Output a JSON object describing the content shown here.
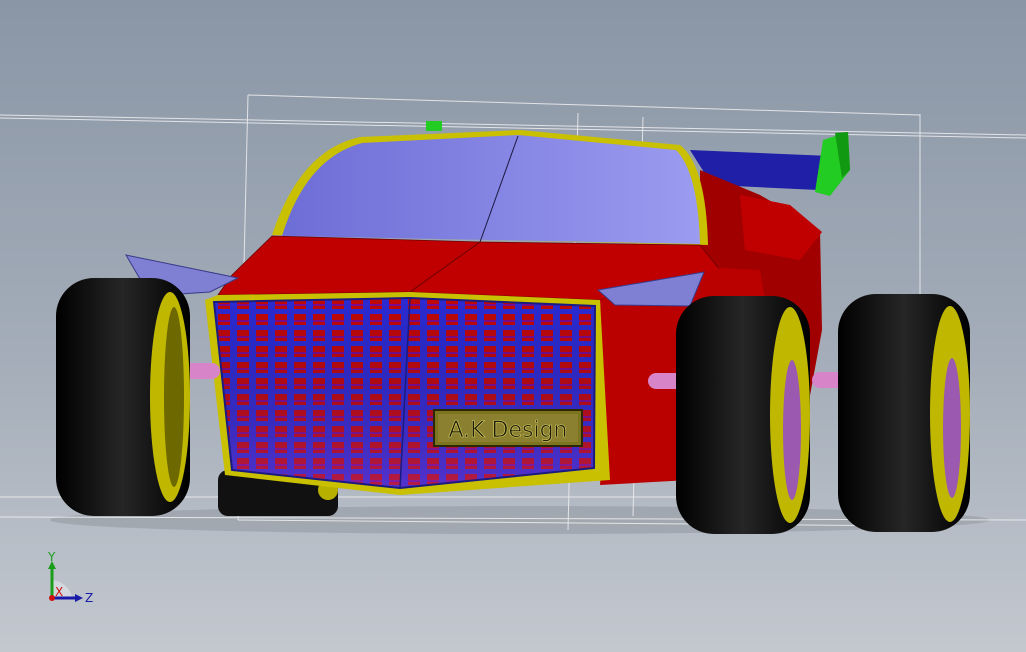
{
  "badge": {
    "text": "A.K Design"
  },
  "triad": {
    "y_label": "Y",
    "z_label": "Z",
    "x_label": "X"
  },
  "colors": {
    "background_top": "#8a96a6",
    "background_bottom": "#c3c8cf",
    "body": "#c00000",
    "body_shadow": "#990000",
    "trim": "#c8c000",
    "windshield": "#8585e0",
    "grille": "#2a2ad0",
    "tire": "#0a0a0a",
    "rim": "#b8b000",
    "axle": "#d884c8",
    "spoiler_wing": "#1e1ea8",
    "spoiler_endplate": "#22cc22",
    "mirror": "#7f7fd4"
  },
  "icons": {
    "triad": "xyz-axis-triad-icon"
  }
}
